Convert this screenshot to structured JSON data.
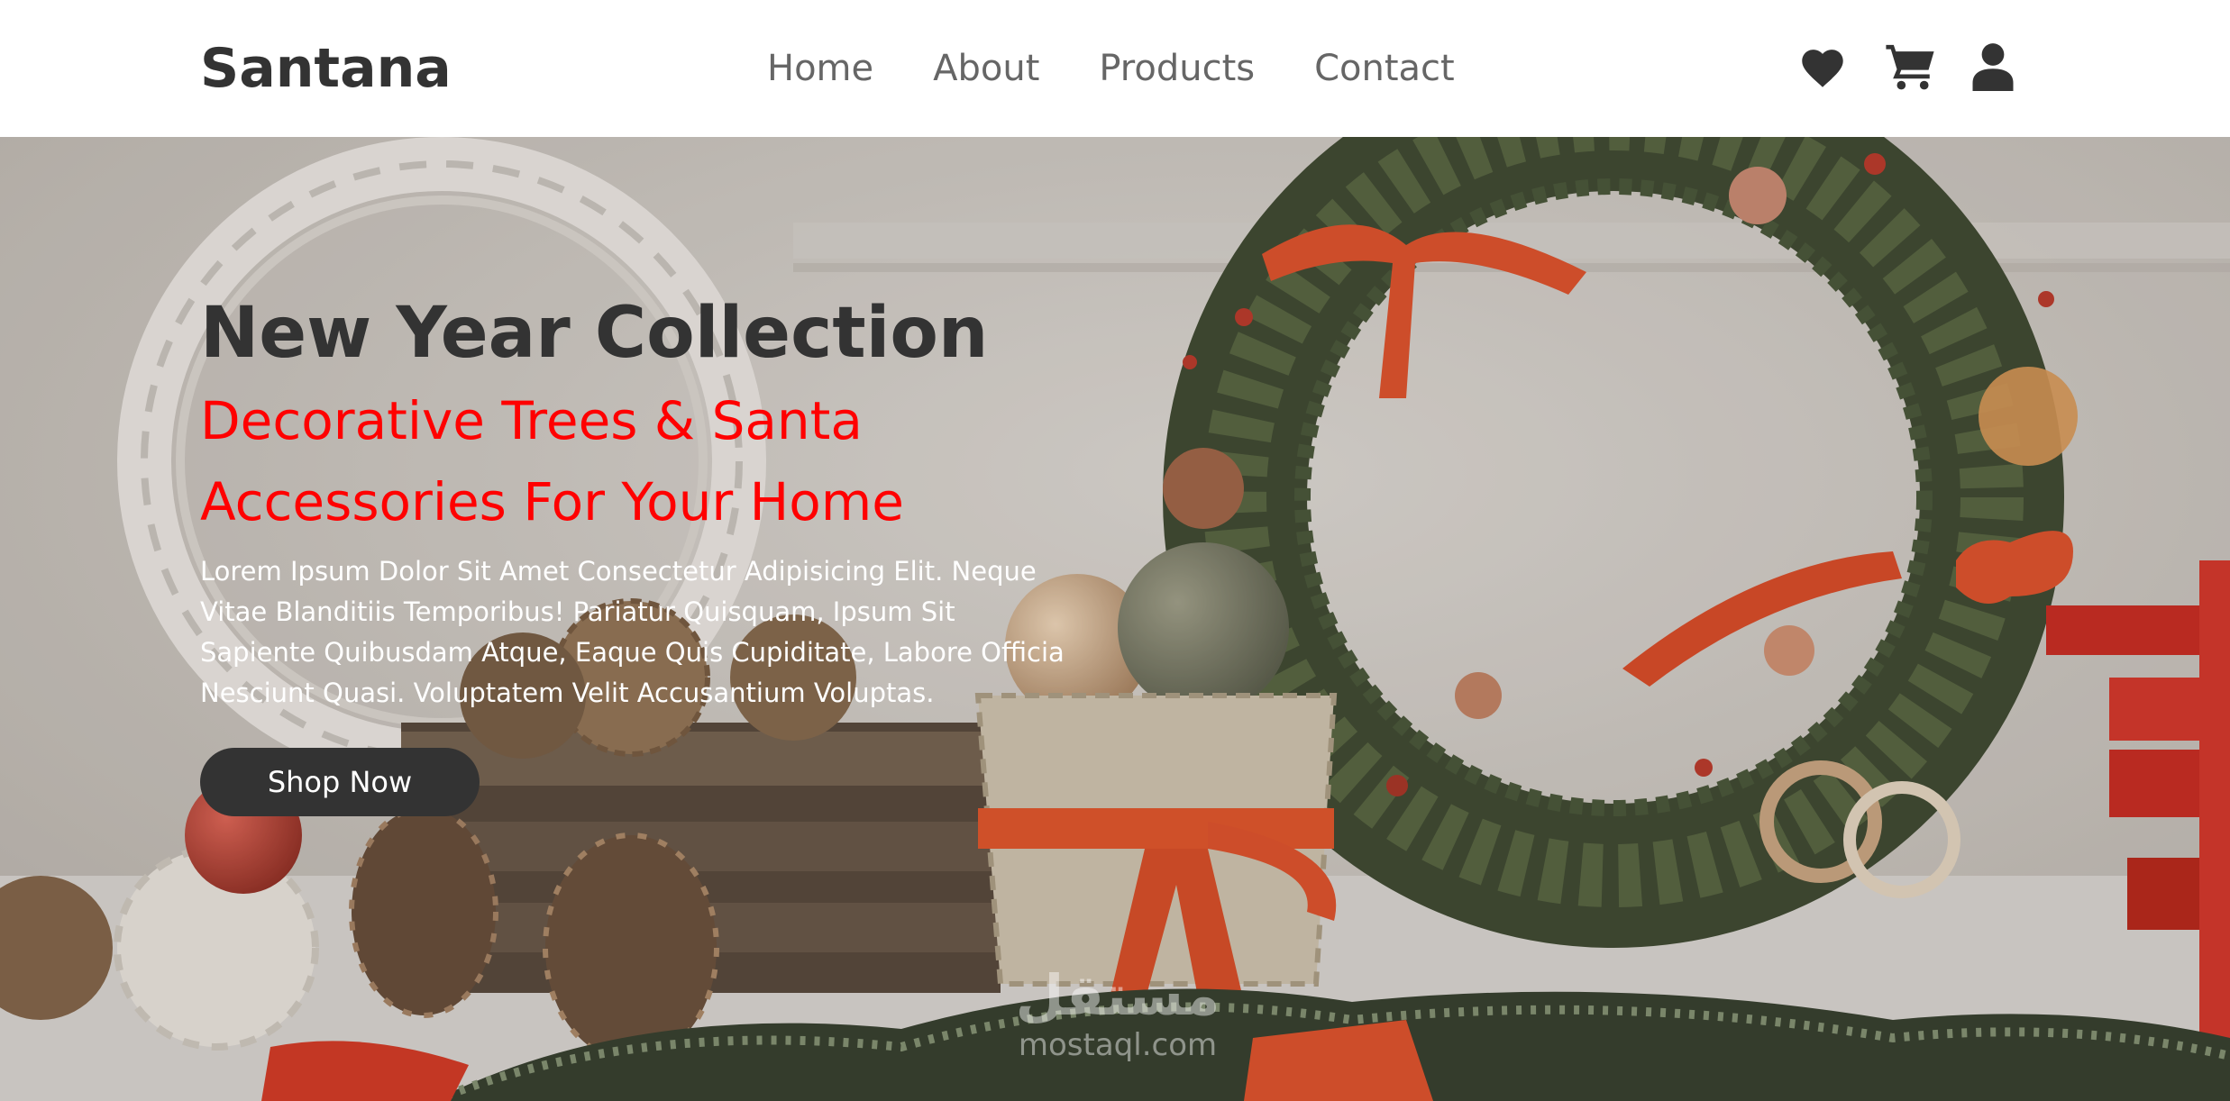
{
  "brand": {
    "name": "Santana"
  },
  "nav": {
    "items": [
      {
        "label": "Home"
      },
      {
        "label": "About"
      },
      {
        "label": "Products"
      },
      {
        "label": "Contact"
      }
    ]
  },
  "header_icons": [
    "heart-icon",
    "cart-icon",
    "user-icon"
  ],
  "hero": {
    "title": "New Year Collection",
    "subtitle_line1": "Decorative Trees & Santa",
    "subtitle_line2": "Accessories For Your Home",
    "description_lines": [
      "Lorem Ipsum Dolor Sit Amet Consectetur Adipisicing Elit. Neque",
      "Vitae Blanditiis Temporibus! Pariatur Quisquam, Ipsum Sit",
      "Sapiente Quibusdam Atque, Eaque Quis Cupiditate, Labore Officia",
      "Nesciunt Quasi. Voluptatem Velit Accusantium Voluptas."
    ],
    "cta_label": "Shop Now"
  },
  "watermark": {
    "arabic": "مستقل",
    "latin": "mostaql.com"
  },
  "colors": {
    "text_dark": "#333333",
    "nav_text": "#666666",
    "accent_red": "#ff0000",
    "button_bg": "#333333",
    "header_bg": "#ffffff"
  }
}
